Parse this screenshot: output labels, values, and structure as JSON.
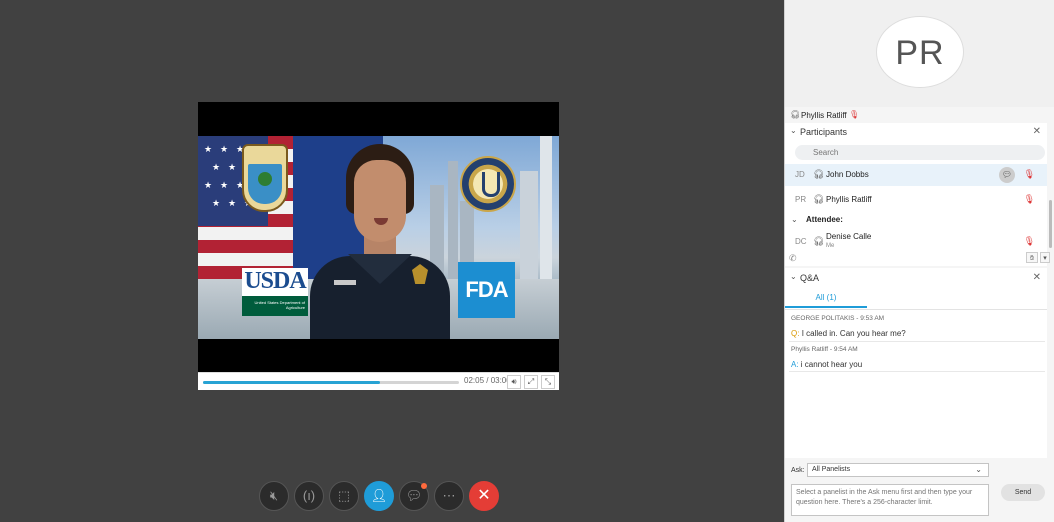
{
  "video": {
    "time_display": "02:05 / 03:00",
    "progress": 0.69,
    "usda_text": "USDA",
    "usda_subtext": "United States Department of Agriculture",
    "fda_text": "FDA"
  },
  "toolbar": {
    "mute_icon": "microphone-slash-icon",
    "audio_icon": "audio-connect-icon",
    "share_icon": "share-icon",
    "participants_icon": "participants-icon",
    "chat_icon": "chat-icon",
    "more_icon": "more-icon",
    "end_icon": "close-icon",
    "active_color": "#1f9cd8",
    "end_color": "#e43d36"
  },
  "panel": {
    "avatar_initials": "PR",
    "active_speaker": "Phyllis Ratliff",
    "participants": {
      "title": "Participants",
      "search_placeholder": "Search",
      "panelists": [
        {
          "initials": "JD",
          "name": "John Dobbs"
        },
        {
          "initials": "PR",
          "name": "Phyllis Ratliff"
        }
      ],
      "attendee_label": "Attendee:",
      "attendees": [
        {
          "initials": "DC",
          "name": "Denise Calle",
          "sub": "Me"
        }
      ]
    },
    "qa": {
      "title": "Q&A",
      "tab_all": "All (1)",
      "entries": [
        {
          "meta": "GEORGE POLITAKIS - 9:53 AM",
          "prefix": "Q:",
          "text": "I called in. Can you hear me?"
        },
        {
          "meta": "Phyllis Ratliff - 9:54 AM",
          "prefix": "A:",
          "text": "i cannot hear you"
        }
      ]
    },
    "ask": {
      "label": "Ask:",
      "selected": "All Panelists",
      "placeholder": "Select a panelist in the Ask menu first and then type your question here. There's a 256-character limit.",
      "send_label": "Send"
    }
  }
}
